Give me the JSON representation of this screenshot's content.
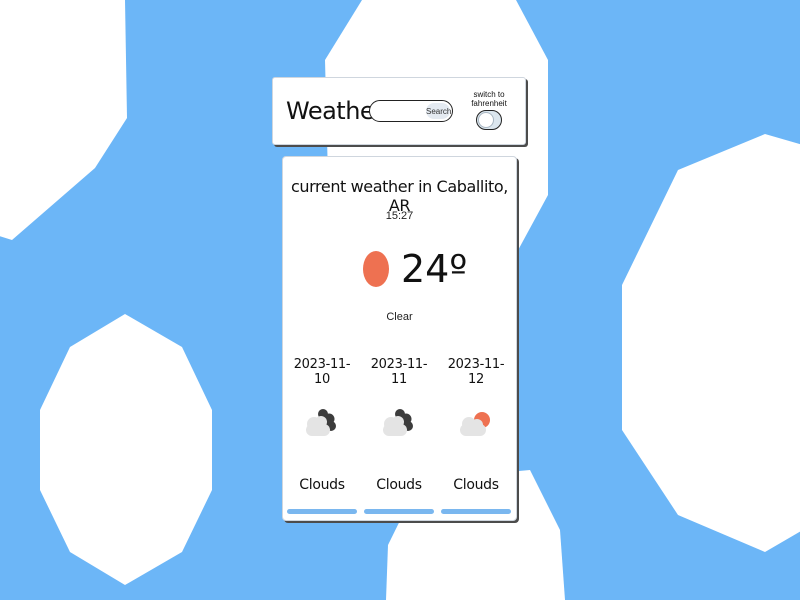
{
  "app": {
    "title": "Weather"
  },
  "search": {
    "placeholder": "",
    "value": "",
    "button_label": "Search"
  },
  "units_toggle": {
    "label": "switch to fahrenheit",
    "enabled": false
  },
  "current": {
    "heading": "current weather in Caballito, AR",
    "time": "15:27",
    "temperature": "24º",
    "condition": "Clear",
    "icon": "sun-icon"
  },
  "forecast": [
    {
      "date": "2023-11-10",
      "condition": "Clouds",
      "icon": "dark-clouds-icon"
    },
    {
      "date": "2023-11-11",
      "condition": "Clouds",
      "icon": "dark-clouds-icon"
    },
    {
      "date": "2023-11-12",
      "condition": "Clouds",
      "icon": "sun-behind-cloud-icon"
    }
  ],
  "colors": {
    "background": "#6cb6f7",
    "sun": "#ee7151",
    "cloud_dark": "#3c3c3c",
    "cloud_light": "#e4e4e4",
    "forecast_bar": "#7ab7ef"
  }
}
